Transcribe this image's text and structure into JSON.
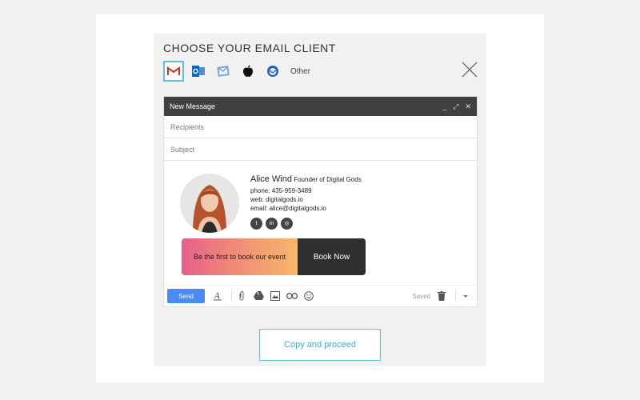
{
  "modal": {
    "title": "CHOOSE YOUR EMAIL CLIENT",
    "clients": [
      {
        "icon": "gmail-icon",
        "selected": true
      },
      {
        "icon": "outlook-icon",
        "selected": false
      },
      {
        "icon": "apple-mail-icon",
        "selected": false
      },
      {
        "icon": "apple-icon",
        "selected": false
      },
      {
        "icon": "thunderbird-icon",
        "selected": false
      }
    ],
    "other_label": "Other"
  },
  "composer": {
    "header_title": "New Message",
    "header_controls": [
      "_",
      "⤢",
      "✕"
    ],
    "recipients_placeholder": "Recipients",
    "subject_placeholder": "Subject"
  },
  "signature": {
    "name": "Alice Wind",
    "role": "Founder of Digital Gods",
    "phone_label": "phone:",
    "phone": "435-959-3489",
    "web_label": "web:",
    "web": "digitalgods.io",
    "email_label": "email:",
    "email": "alice@digitalgods.io",
    "socials": [
      "twitter-icon",
      "linkedin-icon",
      "instagram-icon"
    ],
    "social_glyphs": [
      "t",
      "in",
      "◎"
    ],
    "banner_text": "Be the first to book our event",
    "banner_button": "Book Now"
  },
  "toolbar": {
    "send_label": "Send",
    "saved_label": "Saved"
  },
  "proceed_label": "Copy and proceed",
  "colors": {
    "accent": "#5bc0de",
    "send": "#4a8af4",
    "header": "#404040"
  }
}
